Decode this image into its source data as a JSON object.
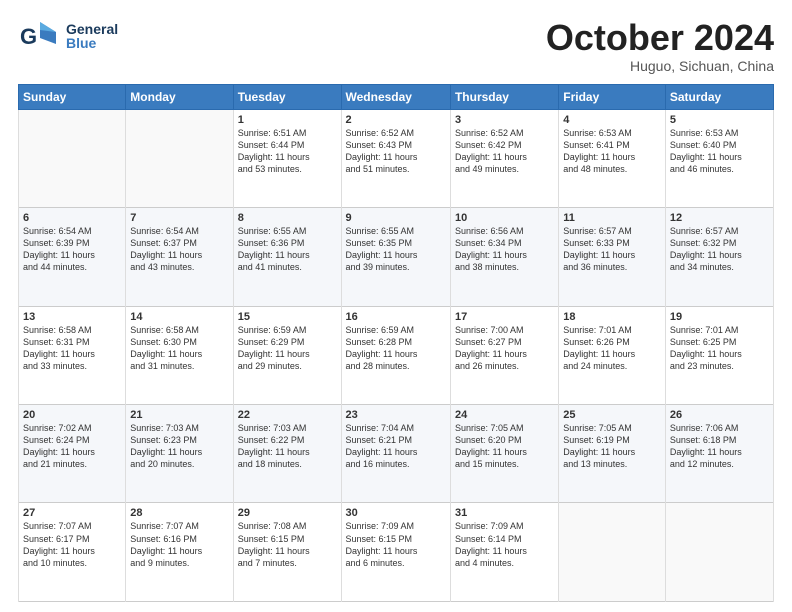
{
  "header": {
    "logo_general": "General",
    "logo_blue": "Blue",
    "month": "October 2024",
    "location": "Huguo, Sichuan, China"
  },
  "days_of_week": [
    "Sunday",
    "Monday",
    "Tuesday",
    "Wednesday",
    "Thursday",
    "Friday",
    "Saturday"
  ],
  "weeks": [
    [
      {
        "day": "",
        "info": ""
      },
      {
        "day": "",
        "info": ""
      },
      {
        "day": "1",
        "info": "Sunrise: 6:51 AM\nSunset: 6:44 PM\nDaylight: 11 hours\nand 53 minutes."
      },
      {
        "day": "2",
        "info": "Sunrise: 6:52 AM\nSunset: 6:43 PM\nDaylight: 11 hours\nand 51 minutes."
      },
      {
        "day": "3",
        "info": "Sunrise: 6:52 AM\nSunset: 6:42 PM\nDaylight: 11 hours\nand 49 minutes."
      },
      {
        "day": "4",
        "info": "Sunrise: 6:53 AM\nSunset: 6:41 PM\nDaylight: 11 hours\nand 48 minutes."
      },
      {
        "day": "5",
        "info": "Sunrise: 6:53 AM\nSunset: 6:40 PM\nDaylight: 11 hours\nand 46 minutes."
      }
    ],
    [
      {
        "day": "6",
        "info": "Sunrise: 6:54 AM\nSunset: 6:39 PM\nDaylight: 11 hours\nand 44 minutes."
      },
      {
        "day": "7",
        "info": "Sunrise: 6:54 AM\nSunset: 6:37 PM\nDaylight: 11 hours\nand 43 minutes."
      },
      {
        "day": "8",
        "info": "Sunrise: 6:55 AM\nSunset: 6:36 PM\nDaylight: 11 hours\nand 41 minutes."
      },
      {
        "day": "9",
        "info": "Sunrise: 6:55 AM\nSunset: 6:35 PM\nDaylight: 11 hours\nand 39 minutes."
      },
      {
        "day": "10",
        "info": "Sunrise: 6:56 AM\nSunset: 6:34 PM\nDaylight: 11 hours\nand 38 minutes."
      },
      {
        "day": "11",
        "info": "Sunrise: 6:57 AM\nSunset: 6:33 PM\nDaylight: 11 hours\nand 36 minutes."
      },
      {
        "day": "12",
        "info": "Sunrise: 6:57 AM\nSunset: 6:32 PM\nDaylight: 11 hours\nand 34 minutes."
      }
    ],
    [
      {
        "day": "13",
        "info": "Sunrise: 6:58 AM\nSunset: 6:31 PM\nDaylight: 11 hours\nand 33 minutes."
      },
      {
        "day": "14",
        "info": "Sunrise: 6:58 AM\nSunset: 6:30 PM\nDaylight: 11 hours\nand 31 minutes."
      },
      {
        "day": "15",
        "info": "Sunrise: 6:59 AM\nSunset: 6:29 PM\nDaylight: 11 hours\nand 29 minutes."
      },
      {
        "day": "16",
        "info": "Sunrise: 6:59 AM\nSunset: 6:28 PM\nDaylight: 11 hours\nand 28 minutes."
      },
      {
        "day": "17",
        "info": "Sunrise: 7:00 AM\nSunset: 6:27 PM\nDaylight: 11 hours\nand 26 minutes."
      },
      {
        "day": "18",
        "info": "Sunrise: 7:01 AM\nSunset: 6:26 PM\nDaylight: 11 hours\nand 24 minutes."
      },
      {
        "day": "19",
        "info": "Sunrise: 7:01 AM\nSunset: 6:25 PM\nDaylight: 11 hours\nand 23 minutes."
      }
    ],
    [
      {
        "day": "20",
        "info": "Sunrise: 7:02 AM\nSunset: 6:24 PM\nDaylight: 11 hours\nand 21 minutes."
      },
      {
        "day": "21",
        "info": "Sunrise: 7:03 AM\nSunset: 6:23 PM\nDaylight: 11 hours\nand 20 minutes."
      },
      {
        "day": "22",
        "info": "Sunrise: 7:03 AM\nSunset: 6:22 PM\nDaylight: 11 hours\nand 18 minutes."
      },
      {
        "day": "23",
        "info": "Sunrise: 7:04 AM\nSunset: 6:21 PM\nDaylight: 11 hours\nand 16 minutes."
      },
      {
        "day": "24",
        "info": "Sunrise: 7:05 AM\nSunset: 6:20 PM\nDaylight: 11 hours\nand 15 minutes."
      },
      {
        "day": "25",
        "info": "Sunrise: 7:05 AM\nSunset: 6:19 PM\nDaylight: 11 hours\nand 13 minutes."
      },
      {
        "day": "26",
        "info": "Sunrise: 7:06 AM\nSunset: 6:18 PM\nDaylight: 11 hours\nand 12 minutes."
      }
    ],
    [
      {
        "day": "27",
        "info": "Sunrise: 7:07 AM\nSunset: 6:17 PM\nDaylight: 11 hours\nand 10 minutes."
      },
      {
        "day": "28",
        "info": "Sunrise: 7:07 AM\nSunset: 6:16 PM\nDaylight: 11 hours\nand 9 minutes."
      },
      {
        "day": "29",
        "info": "Sunrise: 7:08 AM\nSunset: 6:15 PM\nDaylight: 11 hours\nand 7 minutes."
      },
      {
        "day": "30",
        "info": "Sunrise: 7:09 AM\nSunset: 6:15 PM\nDaylight: 11 hours\nand 6 minutes."
      },
      {
        "day": "31",
        "info": "Sunrise: 7:09 AM\nSunset: 6:14 PM\nDaylight: 11 hours\nand 4 minutes."
      },
      {
        "day": "",
        "info": ""
      },
      {
        "day": "",
        "info": ""
      }
    ]
  ]
}
